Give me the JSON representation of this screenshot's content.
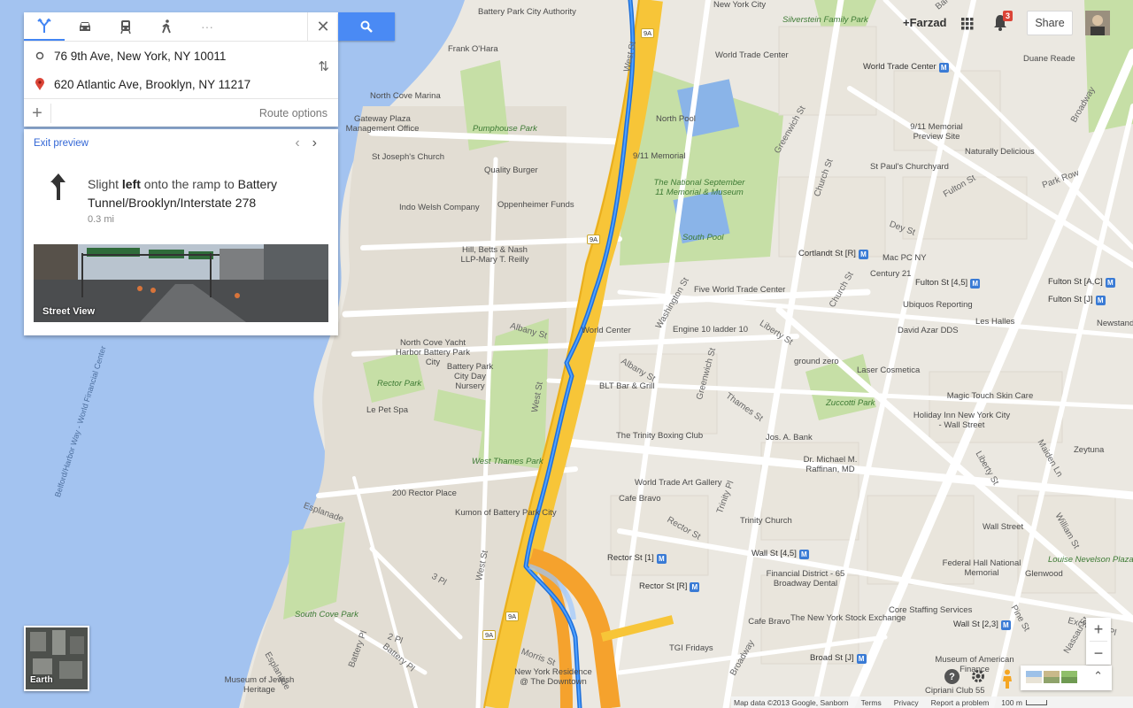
{
  "directions": {
    "modes": [
      {
        "name": "best-route",
        "active": true
      },
      {
        "name": "driving",
        "active": false
      },
      {
        "name": "transit",
        "active": false
      },
      {
        "name": "walking",
        "active": false
      },
      {
        "name": "more",
        "active": false,
        "label": "···"
      }
    ],
    "close_label": "✕",
    "origin": "76 9th Ave, New York, NY 10011",
    "destination": "620 Atlantic Ave, Brooklyn, NY 11217",
    "add_label": "+",
    "route_options": "Route options"
  },
  "step": {
    "exit_preview": "Exit preview",
    "text_a": "Slight ",
    "text_bold": "left",
    "text_b": " onto the ramp to ",
    "text_bold2": "Battery Tunnel/Brooklyn/Interstate 278",
    "distance": "0.3 mi",
    "street_view_label": "Street View"
  },
  "account": {
    "user": "+Farzad",
    "notifications": "3",
    "share": "Share"
  },
  "earth_label": "Earth",
  "zoom": {
    "in": "+",
    "out": "−"
  },
  "help": "?",
  "footer": {
    "data": "Map data ©2013 Google, Sanborn",
    "terms": "Terms",
    "privacy": "Privacy",
    "report": "Report a problem",
    "scale": "100 m"
  },
  "map_labels": [
    {
      "t": "Battery Park City Authority",
      "k": "poi"
    },
    {
      "t": "New York City",
      "k": "poi"
    },
    {
      "t": "Frank O'Hara",
      "k": "poi"
    },
    {
      "t": "North Cove Marina",
      "k": "poi"
    },
    {
      "t": "Gateway Plaza Management Office",
      "k": "poi"
    },
    {
      "t": "Pumphouse Park",
      "k": "park"
    },
    {
      "t": "St Joseph's Church",
      "k": "poi"
    },
    {
      "t": "Quality Burger",
      "k": "poi"
    },
    {
      "t": "Indo Welsh Company",
      "k": "poi"
    },
    {
      "t": "Oppenheimer Funds",
      "k": "poi"
    },
    {
      "t": "Hill, Betts & Nash LLP-Mary T. Reilly",
      "k": "poi"
    },
    {
      "t": "North Cove Yacht Harbor Battery Park City",
      "k": "poi"
    },
    {
      "t": "Battery Park City Day Nursery",
      "k": "poi"
    },
    {
      "t": "Rector Park",
      "k": "park"
    },
    {
      "t": "Le Pet Spa",
      "k": "poi"
    },
    {
      "t": "West Thames Park",
      "k": "park"
    },
    {
      "t": "200 Rector Place",
      "k": "poi"
    },
    {
      "t": "Kumon of Battery Park City",
      "k": "poi"
    },
    {
      "t": "South Cove Park",
      "k": "park"
    },
    {
      "t": "Museum of Jewish Heritage",
      "k": "poi"
    },
    {
      "t": "New York Residence @ The Downtown",
      "k": "poi"
    },
    {
      "t": "World Trade Center",
      "k": "poi"
    },
    {
      "t": "Silverstein Family Park",
      "k": "park"
    },
    {
      "t": "World Trade Center",
      "k": "metro"
    },
    {
      "t": "Duane Reade",
      "k": "poi"
    },
    {
      "t": "North Pool",
      "k": "poi"
    },
    {
      "t": "9/11 Memorial",
      "k": "poi"
    },
    {
      "t": "The National September 11 Memorial & Museum",
      "k": "park"
    },
    {
      "t": "South Pool",
      "k": "park"
    },
    {
      "t": "9/11 Memorial Preview Site",
      "k": "poi"
    },
    {
      "t": "Naturally Delicious",
      "k": "poi"
    },
    {
      "t": "St Paul's Churchyard",
      "k": "poi"
    },
    {
      "t": "Cortlandt St [R]",
      "k": "metro"
    },
    {
      "t": "Mac PC NY",
      "k": "poi"
    },
    {
      "t": "Century 21",
      "k": "poi"
    },
    {
      "t": "Fulton St [4,5]",
      "k": "metro"
    },
    {
      "t": "Fulton St [A,C]",
      "k": "metro"
    },
    {
      "t": "Fulton St [J]",
      "k": "metro"
    },
    {
      "t": "Five World Trade Center",
      "k": "poi"
    },
    {
      "t": "Ubiquos Reporting",
      "k": "poi"
    },
    {
      "t": "Les Halles",
      "k": "poi"
    },
    {
      "t": "Newstand",
      "k": "poi"
    },
    {
      "t": "World Center",
      "k": "poi"
    },
    {
      "t": "Engine 10 ladder 10",
      "k": "poi"
    },
    {
      "t": "David Azar DDS",
      "k": "poi"
    },
    {
      "t": "ground zero",
      "k": "poi"
    },
    {
      "t": "Laser Cosmetica",
      "k": "poi"
    },
    {
      "t": "BLT Bar & Grill",
      "k": "poi"
    },
    {
      "t": "Zuccotti Park",
      "k": "park"
    },
    {
      "t": "Magic Touch Skin Care",
      "k": "poi"
    },
    {
      "t": "Holiday Inn New York City - Wall Street",
      "k": "poi"
    },
    {
      "t": "The Trinity Boxing Club",
      "k": "poi"
    },
    {
      "t": "Jos. A. Bank",
      "k": "poi"
    },
    {
      "t": "Dr. Michael M. Raffinan, MD",
      "k": "poi"
    },
    {
      "t": "Zeytuna",
      "k": "poi"
    },
    {
      "t": "World Trade Art Gallery",
      "k": "poi"
    },
    {
      "t": "Cafe Bravo",
      "k": "poi"
    },
    {
      "t": "Trinity Church",
      "k": "poi"
    },
    {
      "t": "Wall Street",
      "k": "poi"
    },
    {
      "t": "Wall St [4,5]",
      "k": "metro"
    },
    {
      "t": "Rector St [1]",
      "k": "metro"
    },
    {
      "t": "Rector St [R]",
      "k": "metro"
    },
    {
      "t": "Financial District - 65 Broadway Dental",
      "k": "poi"
    },
    {
      "t": "Federal Hall National Memorial",
      "k": "poi"
    },
    {
      "t": "Glenwood",
      "k": "poi"
    },
    {
      "t": "Louise Nevelson Plaza",
      "k": "park"
    },
    {
      "t": "Core Staffing Services",
      "k": "poi"
    },
    {
      "t": "Cafe Bravo",
      "k": "poi"
    },
    {
      "t": "The New York Stock Exchange",
      "k": "poi"
    },
    {
      "t": "Wall St [2,3]",
      "k": "metro"
    },
    {
      "t": "TGI Fridays",
      "k": "poi"
    },
    {
      "t": "Broad St [J]",
      "k": "metro"
    },
    {
      "t": "Museum of American Finance",
      "k": "poi"
    },
    {
      "t": "Cipriani Club 55",
      "k": "poi"
    },
    {
      "t": "West St",
      "k": "street"
    },
    {
      "t": "West St",
      "k": "street"
    },
    {
      "t": "West St",
      "k": "street"
    },
    {
      "t": "Albany St",
      "k": "street"
    },
    {
      "t": "Albany St",
      "k": "street"
    },
    {
      "t": "Liberty St",
      "k": "street"
    },
    {
      "t": "Liberty St",
      "k": "street"
    },
    {
      "t": "Greenwich St",
      "k": "street"
    },
    {
      "t": "Greenwich St",
      "k": "street"
    },
    {
      "t": "Church St",
      "k": "street"
    },
    {
      "t": "Church St",
      "k": "street"
    },
    {
      "t": "Washington St",
      "k": "street"
    },
    {
      "t": "Thames St",
      "k": "street"
    },
    {
      "t": "Rector St",
      "k": "street"
    },
    {
      "t": "Trinity Pl",
      "k": "street"
    },
    {
      "t": "Broadway",
      "k": "street"
    },
    {
      "t": "Broadway",
      "k": "street"
    },
    {
      "t": "Park Row",
      "k": "street"
    },
    {
      "t": "Fulton St",
      "k": "street"
    },
    {
      "t": "Dey St",
      "k": "street"
    },
    {
      "t": "Nassau St",
      "k": "street"
    },
    {
      "t": "William St",
      "k": "street"
    },
    {
      "t": "Pine St",
      "k": "street"
    },
    {
      "t": "Maiden Ln",
      "k": "street"
    },
    {
      "t": "Barclay St",
      "k": "street"
    },
    {
      "t": "Morris St",
      "k": "street"
    },
    {
      "t": "Battery Pl",
      "k": "street"
    },
    {
      "t": "Battery Pl",
      "k": "street"
    },
    {
      "t": "3 Pl",
      "k": "street"
    },
    {
      "t": "2 Pl",
      "k": "street"
    },
    {
      "t": "Esplanade",
      "k": "street"
    },
    {
      "t": "Esplanade",
      "k": "street"
    },
    {
      "t": "Belford/Harbor Way - World Financial Center",
      "k": "water"
    },
    {
      "t": "Exchange Pl",
      "k": "street"
    }
  ],
  "highway_shields": [
    "9A",
    "9A",
    "9A",
    "9A"
  ]
}
